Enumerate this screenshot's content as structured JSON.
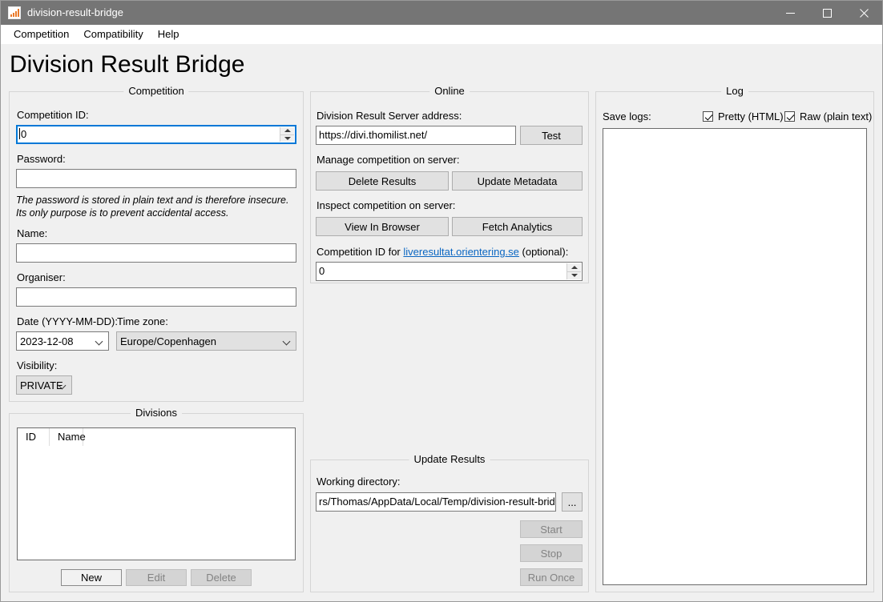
{
  "window": {
    "title": "division-result-bridge",
    "icon": "bar-chart-icon",
    "controls": {
      "minimize": "minimize-icon",
      "maximize": "maximize-icon",
      "close": "close-icon"
    }
  },
  "menubar": {
    "items": [
      {
        "label": "Competition"
      },
      {
        "label": "Compatibility"
      },
      {
        "label": "Help"
      }
    ]
  },
  "page": {
    "title": "Division Result Bridge"
  },
  "competition": {
    "legend": "Competition",
    "competition_id_label": "Competition ID:",
    "competition_id_value": "0",
    "password_label": "Password:",
    "password_value": "",
    "password_note": "The password is stored in plain text and is therefore insecure. Its only purpose is to prevent accidental access.",
    "name_label": "Name:",
    "name_value": "",
    "organiser_label": "Organiser:",
    "organiser_value": "",
    "date_label": "Date (YYYY-MM-DD):",
    "date_value": "2023-12-08",
    "timezone_label": "Time zone:",
    "timezone_value": "Europe/Copenhagen",
    "visibility_label": "Visibility:",
    "visibility_value": "PRIVATE"
  },
  "divisions": {
    "legend": "Divisions",
    "columns": [
      "ID",
      "Name"
    ],
    "rows": [],
    "buttons": {
      "new": "New",
      "edit": "Edit",
      "delete": "Delete"
    }
  },
  "online": {
    "legend": "Online",
    "server_address_label": "Division Result Server address:",
    "server_address_value": "https://divi.thomilist.net/",
    "test_button": "Test",
    "manage_label": "Manage competition on server:",
    "delete_results_button": "Delete Results",
    "update_metadata_button": "Update Metadata",
    "inspect_label": "Inspect competition on server:",
    "view_in_browser_button": "View In Browser",
    "fetch_analytics_button": "Fetch Analytics",
    "liveresultat_prefix": "Competition ID for ",
    "liveresultat_link": "liveresultat.orientering.se",
    "liveresultat_suffix": " (optional):",
    "liveresultat_value": "0"
  },
  "update_results": {
    "legend": "Update Results",
    "working_directory_label": "Working directory:",
    "working_directory_value": "rs/Thomas/AppData/Local/Temp/division-result-bridge",
    "browse_button": "...",
    "start_button": "Start",
    "stop_button": "Stop",
    "run_once_button": "Run Once"
  },
  "log": {
    "legend": "Log",
    "save_logs_label": "Save logs:",
    "pretty_label": "Pretty (HTML)",
    "pretty_checked": true,
    "raw_label": "Raw (plain text)",
    "raw_checked": true,
    "content": ""
  },
  "colors": {
    "titlebar": "#757575",
    "background": "#f0f0f0",
    "accent_focus": "#0078d7",
    "link": "#0a66c2",
    "icon_orange": "#ea7a29"
  }
}
